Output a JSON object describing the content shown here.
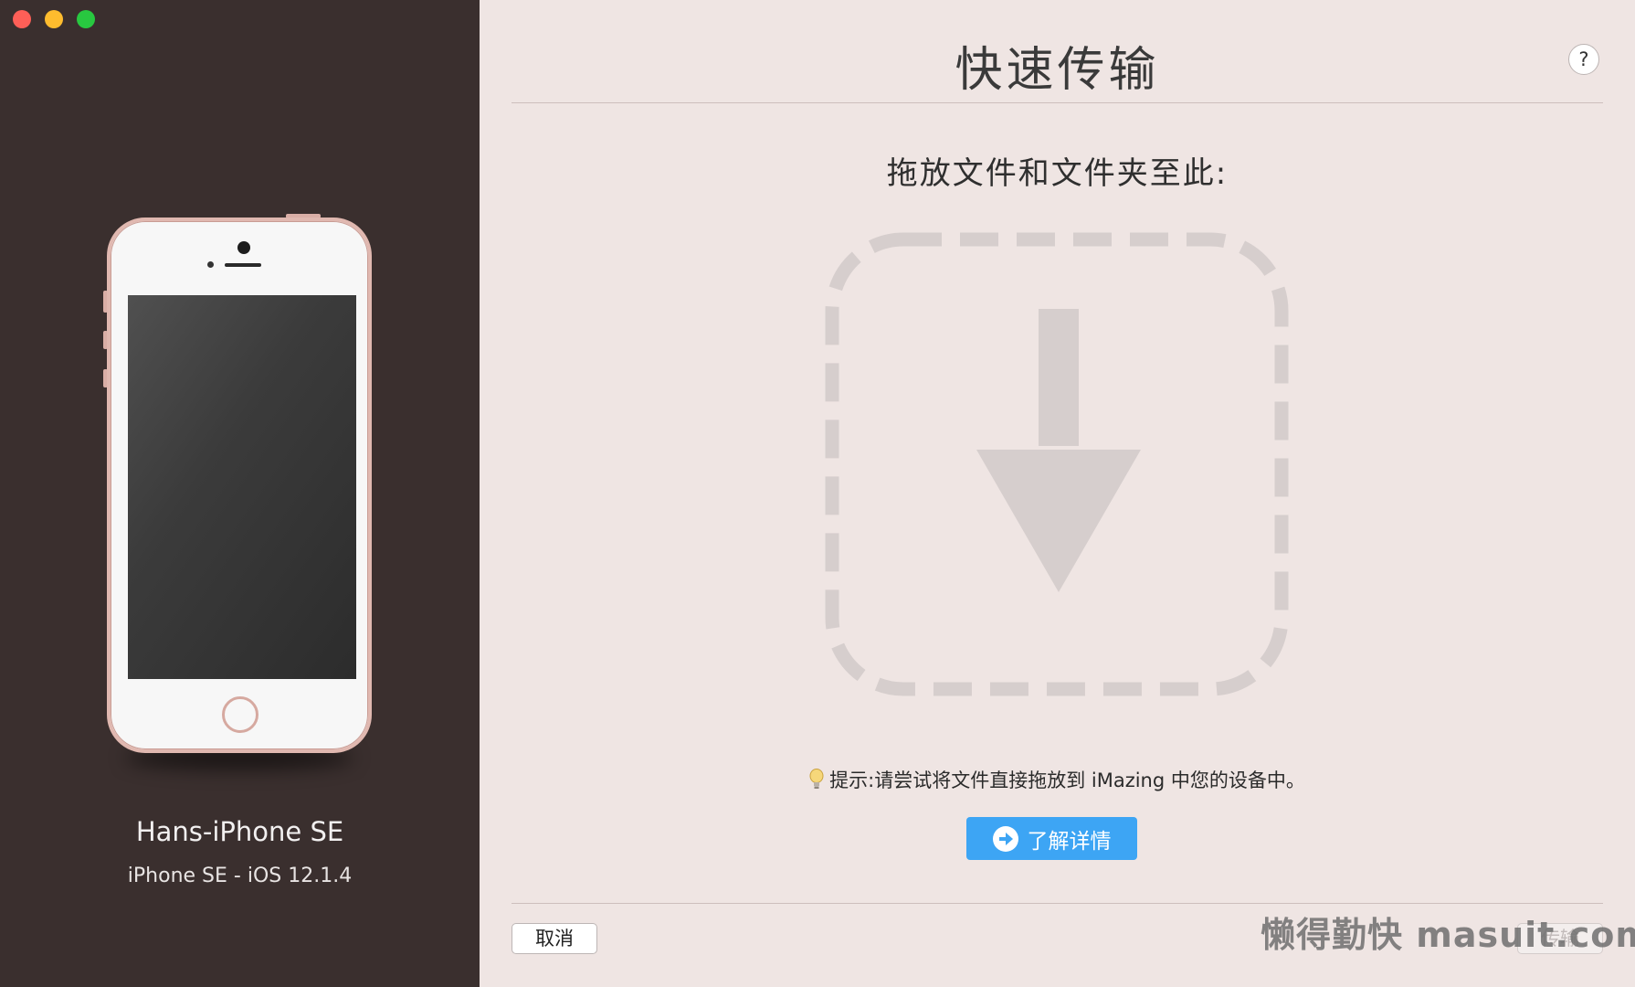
{
  "window": {
    "sidebar_bg": "#3a2f2e",
    "main_bg": "#efe5e3",
    "traffic_lights": [
      "close",
      "minimize",
      "zoom"
    ]
  },
  "sidebar": {
    "device_name": "Hans-iPhone SE",
    "device_info": "iPhone SE - iOS 12.1.4",
    "device_icon": "iphone-se-rose-gold"
  },
  "main": {
    "title": "快速传输",
    "help_label": "?",
    "drop_heading": "拖放文件和文件夹至此:",
    "drop_icon": "download-arrow-icon",
    "hint_text": "提示:请尝试将文件直接拖放到 iMazing 中您的设备中。",
    "learn_more_label": "了解详情",
    "accent": "#3da5f4"
  },
  "footer": {
    "cancel_label": "取消",
    "transfer_label": "传输"
  },
  "watermark": "懒得勤快 masuit.com"
}
